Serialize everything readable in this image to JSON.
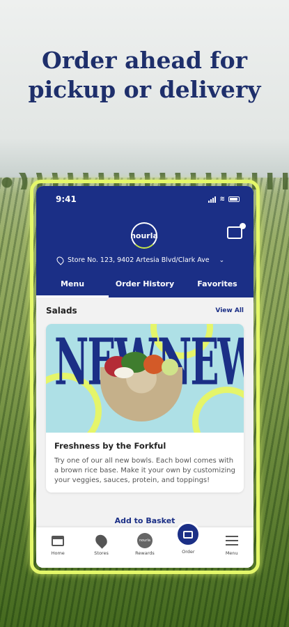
{
  "headline": {
    "line1": "Order ahead for",
    "line2": "pickup or delivery"
  },
  "status_bar": {
    "time": "9:41"
  },
  "brand": {
    "logo_text": "nourla"
  },
  "store": {
    "label": "Store No. 123, 9402 Artesia Blvd/Clark Ave"
  },
  "tabs": [
    {
      "label": "Menu",
      "active": true
    },
    {
      "label": "Order History",
      "active": false
    },
    {
      "label": "Favorites",
      "active": false
    }
  ],
  "section": {
    "title": "Salads",
    "view_all": "View All"
  },
  "card": {
    "banner_word_left": "NEW",
    "banner_word_right": "NEW",
    "title": "Freshness by the Forkful",
    "description": "Try one of our all new bowls. Each bowl comes with a brown rice base. Make it your own by customizing your veggies, sauces, protein, and toppings!"
  },
  "add_to_basket": "Add to Basket",
  "bottom_nav": [
    {
      "label": "Home",
      "icon": "home-icon"
    },
    {
      "label": "Stores",
      "icon": "location-pin-icon"
    },
    {
      "label": "Rewards",
      "icon": "rewards-icon"
    },
    {
      "label": "Order",
      "icon": "basket-icon"
    },
    {
      "label": "Menu",
      "icon": "hamburger-menu-icon"
    }
  ],
  "colors": {
    "brand_navy": "#1b2f86",
    "accent_lime": "#e4f76a",
    "banner_bg": "#aee0e6"
  }
}
